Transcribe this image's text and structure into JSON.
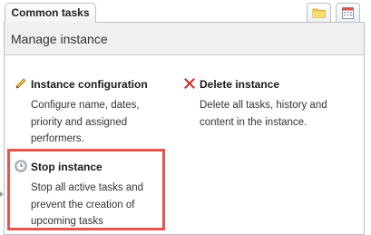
{
  "tabs": [
    {
      "label": "Common tasks"
    }
  ],
  "toolbar": {
    "folder_icon": "folder-icon",
    "calendar_icon": "calendar-icon"
  },
  "panel": {
    "title": "Manage instance"
  },
  "actions": [
    {
      "title": "Instance configuration",
      "description": [
        "Configure name, dates,",
        "priority and assigned",
        "performers."
      ],
      "icon": "pencil-icon"
    },
    {
      "title": "Delete instance",
      "description": [
        "Delete all tasks, history and",
        "content in the instance."
      ],
      "icon": "delete-x-icon",
      "icon_color": "#e03a32"
    },
    {
      "title": "Stop instance",
      "description": [
        "Stop all active tasks and",
        "prevent the creation of",
        "upcoming tasks"
      ],
      "icon": "stop-clock-icon",
      "highlighted": true,
      "highlight_color": "#e8554e"
    }
  ]
}
